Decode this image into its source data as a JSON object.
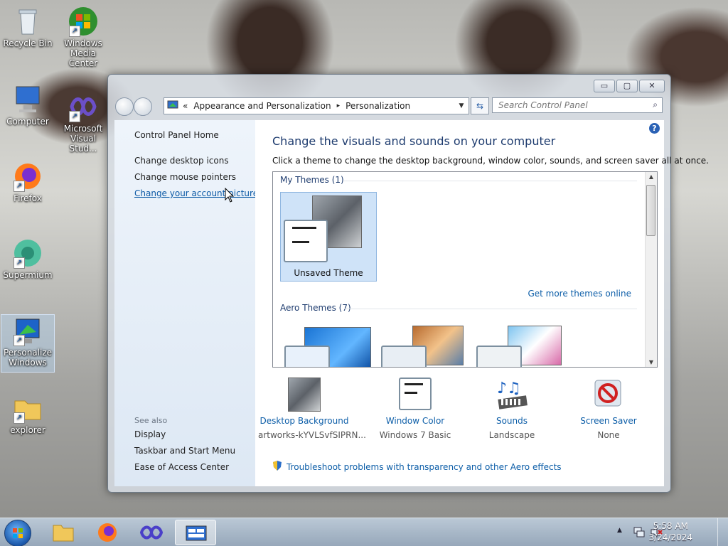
{
  "desktop": {
    "icons": [
      {
        "label_line1": "Recycle Bin",
        "label_line2": ""
      },
      {
        "label_line1": "Windows",
        "label_line2": "Media Center"
      },
      {
        "label_line1": "Computer",
        "label_line2": ""
      },
      {
        "label_line1": "Microsoft",
        "label_line2": "Visual Stud..."
      },
      {
        "label_line1": "Firefox",
        "label_line2": ""
      },
      {
        "label_line1": "Supermium",
        "label_line2": ""
      },
      {
        "label_line1": "Personalize",
        "label_line2": "Windows"
      },
      {
        "label_line1": "explorer",
        "label_line2": ""
      }
    ]
  },
  "window": {
    "controls": {
      "minimize": "▭",
      "maximize": "▢",
      "close": "✕"
    },
    "address": {
      "prefix": "«",
      "crumb1": "Appearance and Personalization",
      "sep": "▸",
      "crumb2": "Personalization"
    },
    "search_placeholder": "Search Control Panel"
  },
  "sidebar": {
    "home": "Control Panel Home",
    "links": [
      "Change desktop icons",
      "Change mouse pointers",
      "Change your account picture"
    ],
    "see_also_label": "See also",
    "see_also": [
      "Display",
      "Taskbar and Start Menu",
      "Ease of Access Center"
    ]
  },
  "main": {
    "title": "Change the visuals and sounds on your computer",
    "description": "Click a theme to change the desktop background, window color, sounds, and screen saver all at once.",
    "my_themes_label": "My Themes (1)",
    "unsaved_theme": "Unsaved Theme",
    "get_more_link": "Get more themes online",
    "aero_themes_label": "Aero Themes (7)",
    "bottom": [
      {
        "label": "Desktop Background",
        "sub": "artworks-kYVLSvfSIPRN..."
      },
      {
        "label": "Window Color",
        "sub": "Windows 7 Basic"
      },
      {
        "label": "Sounds",
        "sub": "Landscape"
      },
      {
        "label": "Screen Saver",
        "sub": "None"
      }
    ],
    "troubleshoot": "Troubleshoot problems with transparency and other Aero effects"
  },
  "taskbar": {
    "time": "5:58 AM",
    "date": "3/24/2024"
  },
  "colors": {
    "link": "#0d5ea8",
    "heading": "#1d3b6e",
    "sidebar_bg": "#e6eef8",
    "selected_tile": "#cfe3f8"
  }
}
